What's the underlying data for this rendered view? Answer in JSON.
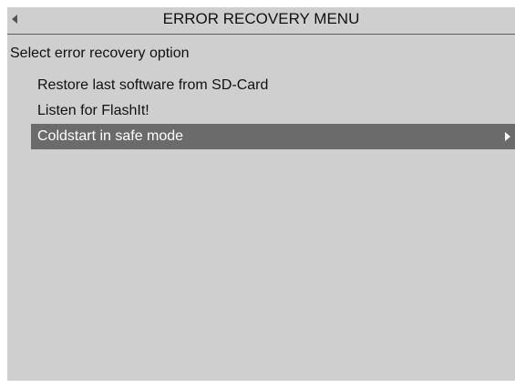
{
  "header": {
    "title": "ERROR RECOVERY MENU",
    "back_icon": "triangle-left-icon"
  },
  "prompt": "Select error recovery option",
  "menu": {
    "items": [
      {
        "label": "Restore last software from SD-Card"
      },
      {
        "label": "Listen for FlashIt!"
      },
      {
        "label": "Coldstart in safe mode",
        "selected": true,
        "submenu_icon": "triangle-right-icon"
      }
    ]
  },
  "colors": {
    "screen_background": "#cfcfcf",
    "selected_background": "#6b6b6b",
    "selected_text": "#ffffff",
    "text": "#111111"
  }
}
